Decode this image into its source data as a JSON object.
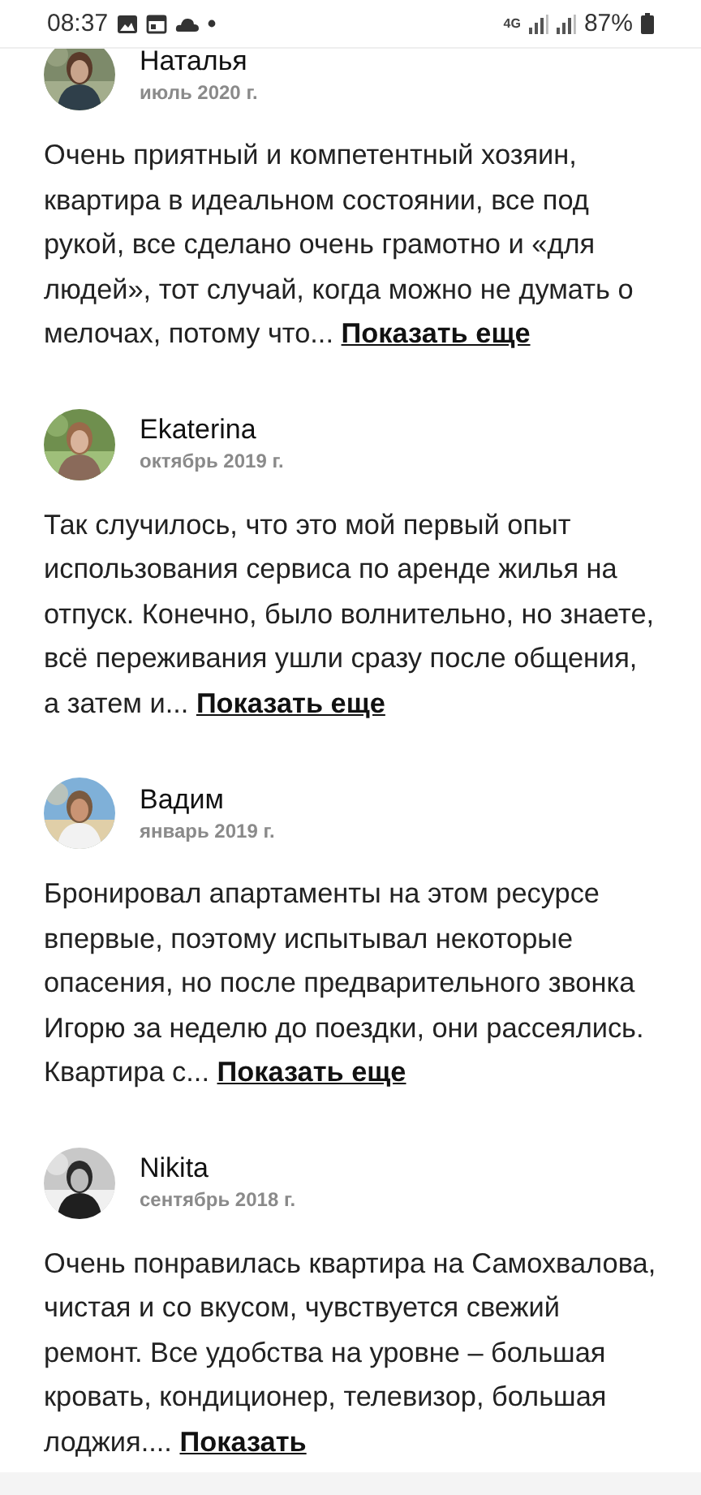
{
  "status_bar": {
    "time": "08:37",
    "network": "4G",
    "battery": "87%"
  },
  "reviews": [
    {
      "name": "Наталья",
      "date": "июль 2020 г.",
      "text": "Очень приятный и компетентный хозяин, квартира в идеальном состоянии, все под рукой, все сделано очень грамотно и «для людей», тот случай, когда можно не думать о мелочах, потому что...",
      "link": "Показать еще"
    },
    {
      "name": "Ekaterina",
      "date": "октябрь 2019 г.",
      "text": "Так случилось, что это мой первый опыт использования сервиса по аренде жилья на отпуск. Конечно, было волнительно, но знаете, всё переживания ушли сразу после общения, а затем и...",
      "link": "Показать еще"
    },
    {
      "name": "Вадим",
      "date": "январь 2019 г.",
      "text": "Бронировал апартаменты на этом ресурсе впервые, поэтому испытывал некоторые опасения, но после предварительного звонка Игорю за неделю до поездки, они рассеялись. Квартира с...",
      "link": "Показать еще"
    },
    {
      "name": "Nikita",
      "date": "сентябрь 2018 г.",
      "text": "Очень понравилась квартира на Самохвалова, чистая и со вкусом, чувствуется свежий ремонт. Все удобства на уровне – большая кровать, кондиционер, телевизор, большая лоджия....",
      "link": "Показать"
    }
  ]
}
